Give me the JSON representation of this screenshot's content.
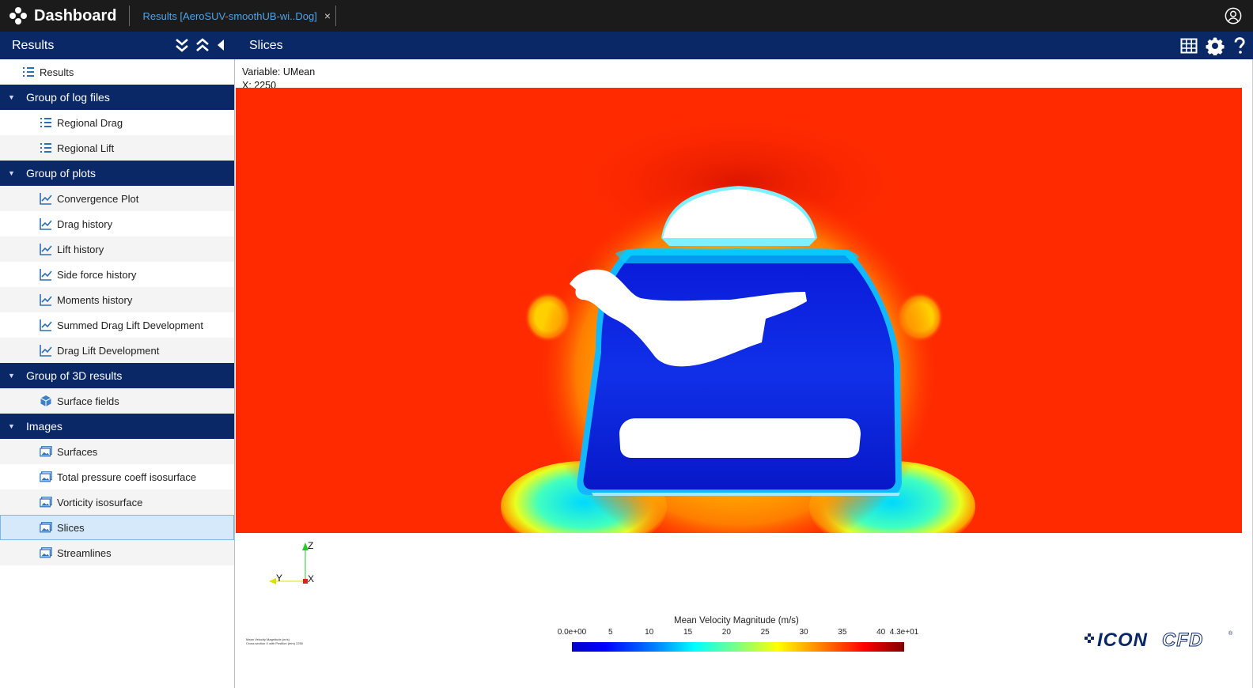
{
  "app": {
    "title": "Dashboard",
    "tab_label": "Results [AeroSUV-smoothUB-wi..Dog]",
    "tab_close": "×"
  },
  "navbar": {
    "left_title": "Results",
    "right_title": "Slices"
  },
  "sidebar": {
    "root_label": "Results",
    "groups": [
      {
        "label": "Group of log files",
        "items": [
          "Regional Drag",
          "Regional Lift"
        ]
      },
      {
        "label": "Group of plots",
        "items": [
          "Convergence Plot",
          "Drag history",
          "Lift history",
          "Side force history",
          "Moments history",
          "Summed Drag Lift Development",
          "Drag Lift Development"
        ]
      },
      {
        "label": "Group of 3D results",
        "items": [
          "Surface fields"
        ]
      },
      {
        "label": "Images",
        "items": [
          "Surfaces",
          "Total pressure coeff isosurface",
          "Vorticity isosurface",
          "Slices",
          "Streamlines"
        ],
        "selected": "Slices"
      }
    ]
  },
  "viewer": {
    "variable_line": "Variable: UMean",
    "position_line": "X: 2250",
    "axes": {
      "z": "Z",
      "y": "Y",
      "x": "X"
    },
    "caption_line1": "Mean Velocity Magnitude (m/s)",
    "caption_line2": "Cross section X with Position (mm) 2250",
    "legend": {
      "title": "Mean Velocity Magnitude (m/s)",
      "ticks": [
        "0.0e+00",
        "5",
        "10",
        "15",
        "20",
        "25",
        "30",
        "35",
        "40",
        "4.3e+01"
      ],
      "min": 0,
      "max": 43
    },
    "logo_text_a": "ICON",
    "logo_text_b": "CFD",
    "logo_mark": "®"
  },
  "colors": {
    "topbar": "#1b1b1b",
    "navbar": "#0b2866",
    "accent": "#4fa3e8",
    "field_red": "#ff2a00",
    "field_blue": "#0a18d8"
  },
  "icons": {
    "brand": "dashboard-nodes-icon",
    "user": "user-circle-icon",
    "expand_all": "double-chevron-down-icon",
    "collapse_all": "double-chevron-up-icon",
    "collapse_sidebar": "triangle-left-icon",
    "table": "table-grid-icon",
    "settings": "gear-icon",
    "help": "question-icon"
  }
}
